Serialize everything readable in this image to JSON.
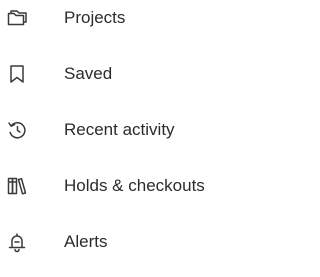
{
  "menu": {
    "items": [
      {
        "label": "Projects",
        "icon": "folder-icon"
      },
      {
        "label": "Saved",
        "icon": "bookmark-icon"
      },
      {
        "label": "Recent activity",
        "icon": "history-icon"
      },
      {
        "label": "Holds & checkouts",
        "icon": "library-books-icon"
      },
      {
        "label": "Alerts",
        "icon": "bell-icon"
      }
    ]
  },
  "colors": {
    "text": "#2b2b2b",
    "icon": "#3a3a3a",
    "background": "#ffffff"
  }
}
